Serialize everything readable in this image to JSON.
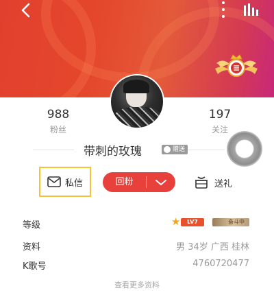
{
  "header": {
    "back_icon": "chevron-left-icon",
    "more_icon": "more-vertical-icon",
    "rank_icon": "bar-chart-icon",
    "gradient_colors": [
      "#e2402e",
      "#c8287a"
    ]
  },
  "profile": {
    "fans_count": "988",
    "fans_label": "粉丝",
    "follow_count": "197",
    "follow_label": "关注",
    "username": "带刺的玫瑰",
    "gift_tag": "赠送"
  },
  "actions": {
    "message_label": "私信",
    "follow_back_label": "回粉",
    "gift_label": "送礼",
    "accent_color": "#e8403b",
    "highlight_color": "#f5c33b"
  },
  "info": {
    "level_key": "等级",
    "level_badge": "LV7",
    "rank_badge": "奋斗中",
    "profile_key": "资料",
    "profile_value": "男  34岁  广西 桂林",
    "k_id_key": "K歌号",
    "k_id_value": "4760720477"
  },
  "footer": {
    "more_link": "查看更多资料"
  }
}
